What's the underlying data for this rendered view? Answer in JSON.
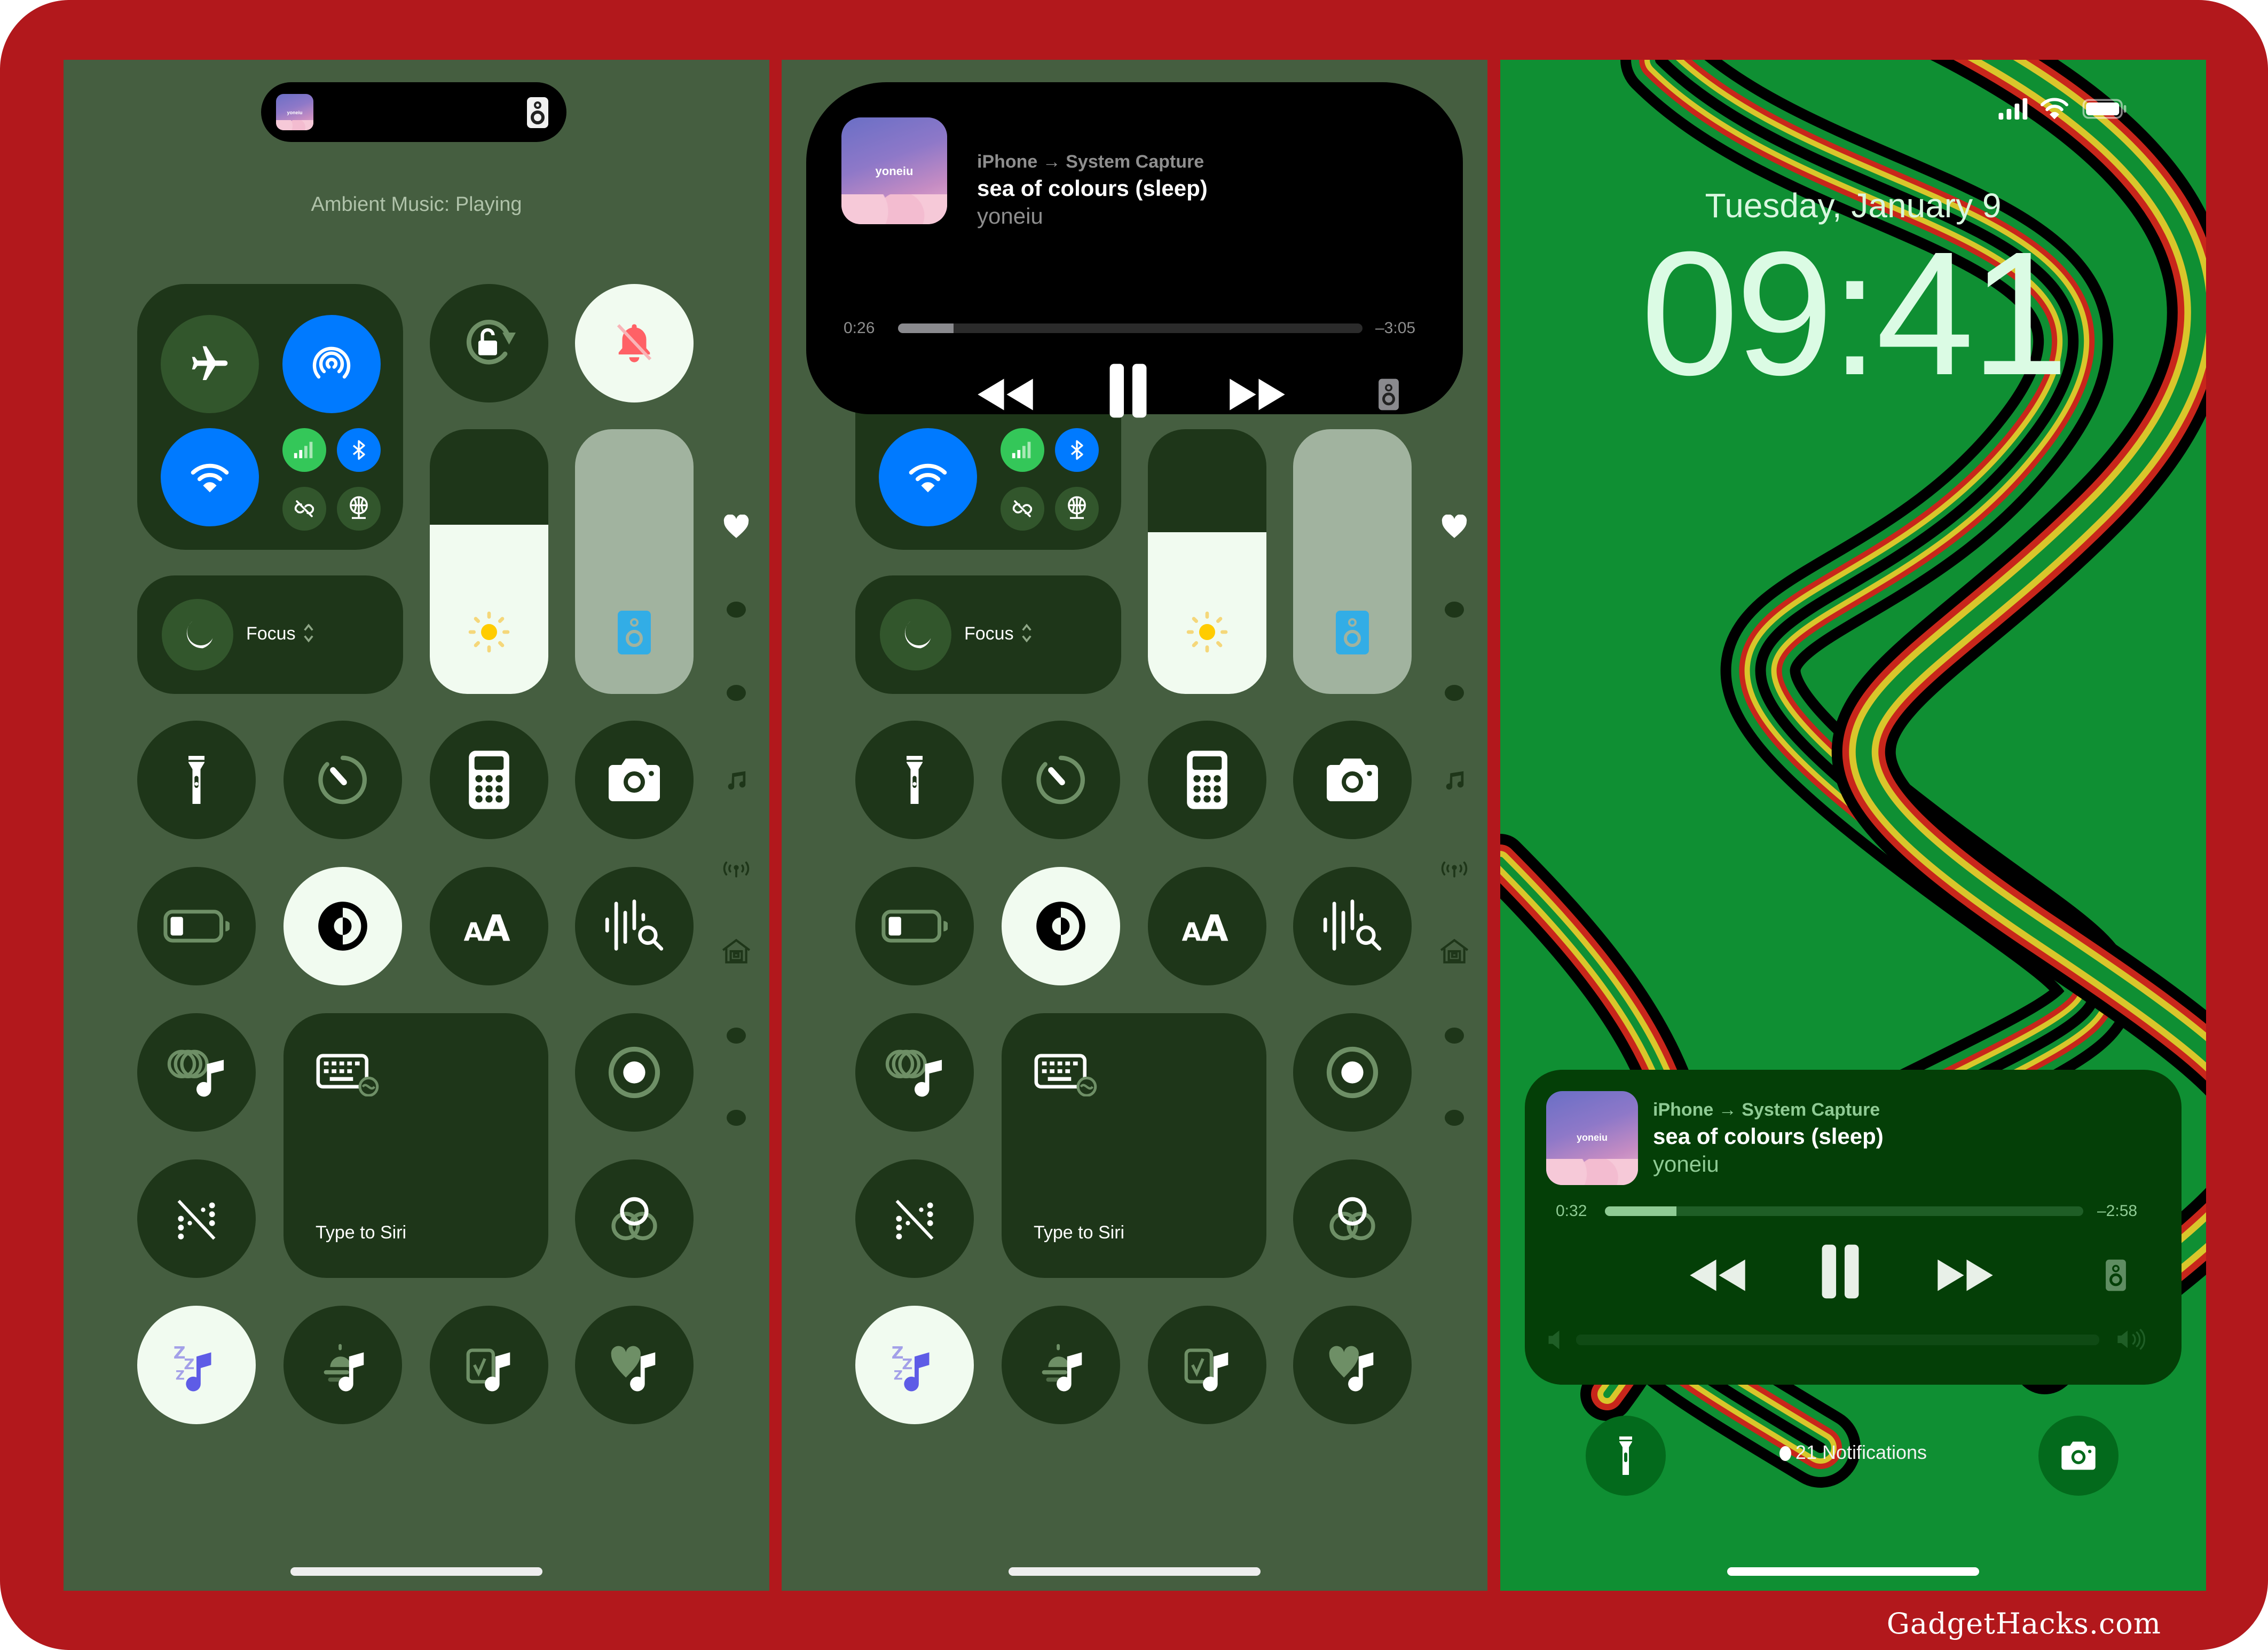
{
  "watermark": "GadgetHacks.com",
  "colors": {
    "frame": "#B2181C",
    "panel_bg": "#455E40",
    "tile_bg": "#1E3619",
    "tile_active_light": "#F1FBF0",
    "accent_blue": "#007AFF",
    "cellular_green": "#34C759",
    "silent_red": "#FF6166",
    "lockscreen_green": "#0F8F33"
  },
  "control_center_1": {
    "island": {
      "art_label": "yoneiu",
      "output_icon": "speaker-icon"
    },
    "status_text": "Ambient Music: Playing",
    "connectivity": [
      {
        "name": "airplane-mode",
        "icon": "airplane-icon",
        "active": false
      },
      {
        "name": "airdrop",
        "icon": "airdrop-icon",
        "active": true
      },
      {
        "name": "wifi",
        "icon": "wifi-icon",
        "active": true
      },
      {
        "name": "cellular",
        "icon": "cellular-icon",
        "active": true
      },
      {
        "name": "bluetooth",
        "icon": "bluetooth-icon",
        "active": true
      },
      {
        "name": "vpn",
        "icon": "link-slash-icon",
        "active": false
      },
      {
        "name": "personal-hotspot",
        "icon": "globe-network-icon",
        "active": false
      }
    ],
    "focus_label": "Focus",
    "brightness_level": 0.64,
    "volume_level": 0.0,
    "rows": [
      [
        "flashlight",
        "timer",
        "calculator",
        "camera"
      ],
      [
        "low-power-mode",
        "dark-mode",
        "text-size",
        "recognize-music"
      ],
      [
        "ambient-music-chill",
        "type-to-siri",
        "screen-recording"
      ],
      [
        "vocal-shortcuts-off",
        "color-filters"
      ],
      [
        "ambient-sleep",
        "ambient-wellbeing",
        "ambient-productivity",
        "ambient-chill"
      ]
    ],
    "type_to_siri_label": "Type to Siri",
    "page_indicators": [
      "favorites-heart",
      "page-dot",
      "page-dot",
      "music-note",
      "connectivity",
      "home",
      "page-dot",
      "page-dot"
    ]
  },
  "control_center_2": {
    "now_playing": {
      "source": "iPhone → System Capture",
      "title": "sea of colours (sleep)",
      "artist": "yoneiu",
      "art_label": "yoneiu",
      "elapsed": "0:26",
      "remaining": "–3:05",
      "progress": 0.12
    },
    "focus_label": "Focus",
    "brightness_level": 0.61,
    "type_to_siri_label": "Type to Siri"
  },
  "lock_screen": {
    "date": "Tuesday, January 9",
    "time": "09:41",
    "now_playing": {
      "source": "iPhone → System Capture",
      "title": "sea of colours (sleep)",
      "artist": "yoneiu",
      "art_label": "yoneiu",
      "elapsed": "0:32",
      "remaining": "–2:58",
      "progress": 0.15,
      "volume": 0.0
    },
    "notifications": "21 Notifications"
  }
}
